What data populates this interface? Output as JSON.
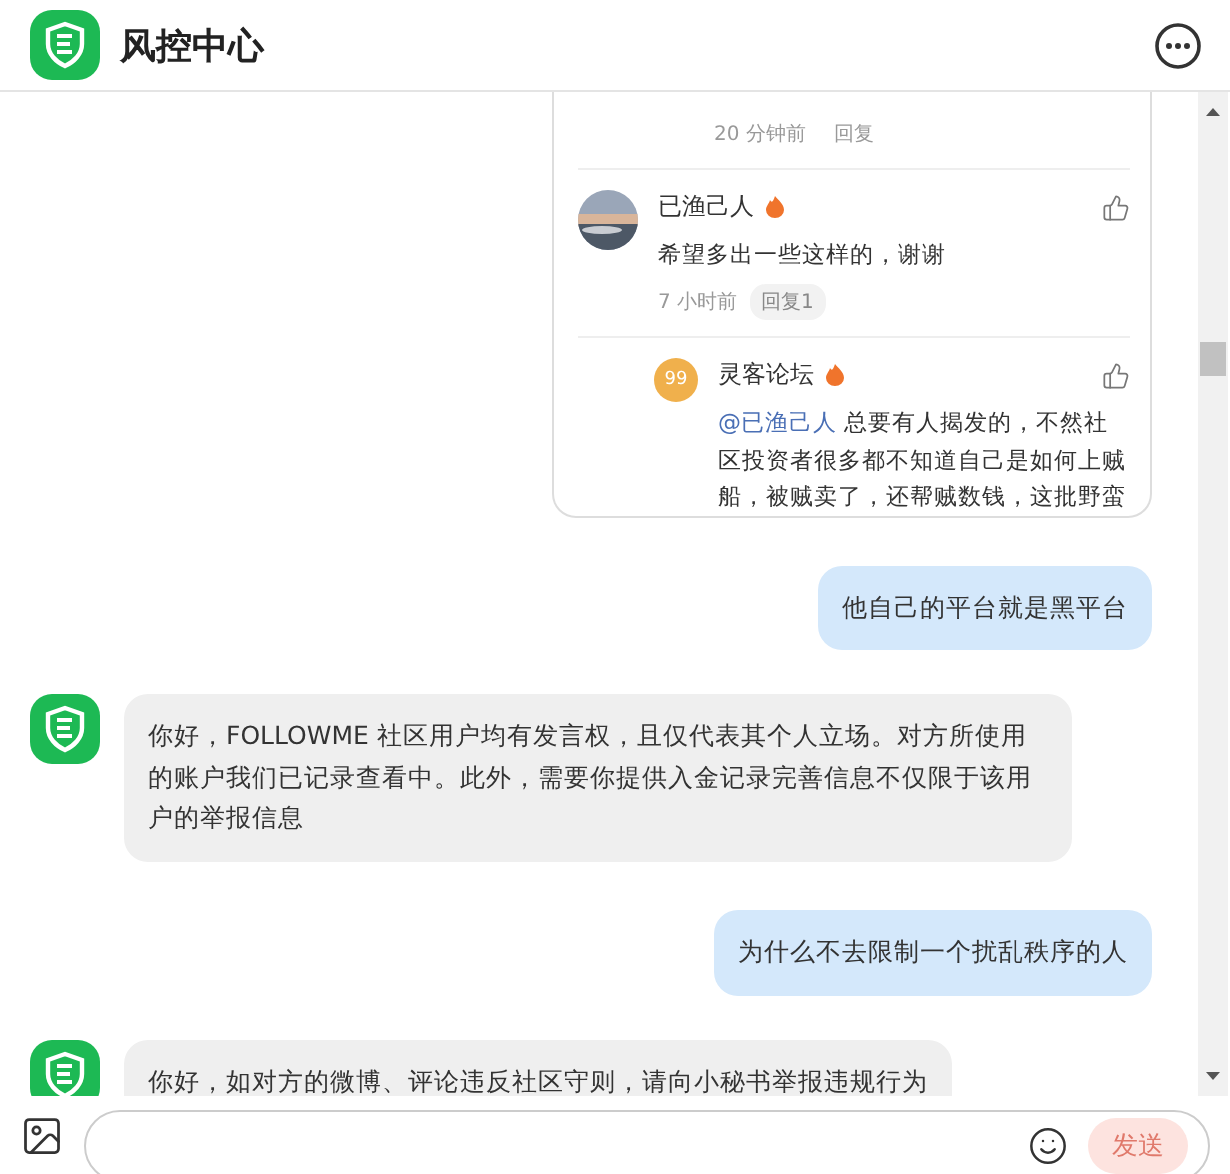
{
  "header": {
    "title": "风控中心"
  },
  "thread_card": {
    "top_comment_meta": {
      "time": "20 分钟前",
      "reply_label": "回复"
    },
    "comment": {
      "author": "已渔己人",
      "text": "希望多出一些这样的，谢谢",
      "time": "7 小时前",
      "replies_label": "回复1",
      "reply": {
        "avatar_text": "99",
        "author": "灵客论坛",
        "mention": "@已渔己人",
        "text": "总要有人揭发的，不然社区投资者很多都不知道自己是如何上贼船，被贼卖了，还帮贼数钱，这批野蛮"
      }
    }
  },
  "messages": [
    {
      "kind": "user",
      "text": "他自己的平台就是黑平台"
    },
    {
      "kind": "bot",
      "text": "你好，FOLLOWME 社区用户均有发言权，且仅代表其个人立场。对方所使用的账户我们已记录查看中。此外，需要你提供入金记录完善信息不仅限于该用户的举报信息"
    },
    {
      "kind": "user",
      "text": "为什么不去限制一个扰乱秩序的人"
    },
    {
      "kind": "bot",
      "text": "你好，如对方的微博、评论违反社区守则，请向小秘书举报违规行为"
    }
  ],
  "composer": {
    "send_label": "发送",
    "send_disabled": true
  }
}
